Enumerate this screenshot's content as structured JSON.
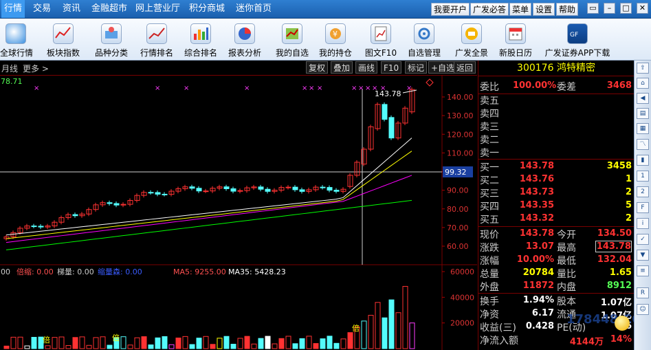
{
  "menubar": {
    "items": [
      "行情",
      "交易",
      "资讯",
      "金融超市",
      "网上营业厅",
      "积分商城",
      "迷你首页"
    ],
    "buttons": [
      "我要开户",
      "广发必答",
      "菜单",
      "设置",
      "帮助"
    ]
  },
  "toolbar": {
    "items": [
      "全球行情",
      "板块指数",
      "品种分类",
      "行情排名",
      "综合排名",
      "报表分析",
      "我的自选",
      "我的持仓",
      "图文F10",
      "自选管理",
      "广发全景",
      "新股日历",
      "广发证券APP下载"
    ]
  },
  "chart_header": {
    "period": "月线",
    "more": "更多 >",
    "buttons": [
      "复权",
      "叠加",
      "画线",
      "F10",
      "标记",
      "+自选",
      "返回"
    ]
  },
  "price_chart": {
    "top_left_value": "78.71",
    "high_label": "143.78",
    "crosshair_value": "99.32",
    "y_ticks": [
      "140.00",
      "130.00",
      "120.00",
      "110.00",
      "100.00",
      "90.00",
      "80.00",
      "70.00",
      "60.00"
    ]
  },
  "volume_chart": {
    "labels": [
      "00",
      "倍缩: 0.00",
      "梯量: 0.00",
      "缩量森: 0.00",
      "MA5: 9255.00",
      "MA35: 5428.23"
    ],
    "y_ticks": [
      "60000",
      "40000",
      "20000"
    ],
    "marker": "倍"
  },
  "stock": {
    "code": "300176",
    "name": "鸿特精密",
    "weibi_label": "委比",
    "weibi": "100.00%",
    "weicha_label": "委差",
    "weicha": "3468",
    "sell": [
      {
        "label": "卖五",
        "price": "",
        "vol": ""
      },
      {
        "label": "卖四",
        "price": "",
        "vol": ""
      },
      {
        "label": "卖三",
        "price": "",
        "vol": ""
      },
      {
        "label": "卖二",
        "price": "",
        "vol": ""
      },
      {
        "label": "卖一",
        "price": "",
        "vol": ""
      }
    ],
    "buy": [
      {
        "label": "买一",
        "price": "143.78",
        "vol": "3458"
      },
      {
        "label": "买二",
        "price": "143.76",
        "vol": "1"
      },
      {
        "label": "买三",
        "price": "143.73",
        "vol": "2"
      },
      {
        "label": "买四",
        "price": "143.35",
        "vol": "5"
      },
      {
        "label": "买五",
        "price": "143.32",
        "vol": "2"
      }
    ],
    "stats": [
      {
        "l1": "现价",
        "v1": "143.78",
        "l2": "今开",
        "v2": "134.50"
      },
      {
        "l1": "涨跌",
        "v1": "13.07",
        "l2": "最高",
        "v2": "143.78"
      },
      {
        "l1": "涨幅",
        "v1": "10.00%",
        "l2": "最低",
        "v2": "132.04"
      },
      {
        "l1": "总量",
        "v1": "20784",
        "l2": "量比",
        "v2": "1.65"
      },
      {
        "l1": "外盘",
        "v1": "11872",
        "l2": "内盘",
        "v2": "8912"
      }
    ],
    "stats2": [
      {
        "l1": "换手",
        "v1": "1.94%",
        "l2": "股本",
        "v2": "1.07亿"
      },
      {
        "l1": "净资",
        "v1": "6.17",
        "l2": "流通",
        "v2": "1.07亿"
      },
      {
        "l1": "收益(三)",
        "v1": "0.428",
        "l2": "PE(动)",
        "v2": "16"
      }
    ],
    "net_inflow_label": "净流入额",
    "net_inflow": "4144万",
    "net_inflow_pct": "14%"
  },
  "watermark": "178448.COM",
  "side_icons": [
    "arrow-up-left-icon",
    "home-icon",
    "arrow-left-icon",
    "arrow-right-icon",
    "table-icon",
    "grid-icon",
    "line-chart-icon",
    "kline-icon",
    "num1-icon",
    "num2-icon",
    "f10-icon",
    "info-icon",
    "tick-icon",
    "arrow-down-icon",
    "list-icon",
    "rsi-icon",
    "smile-icon"
  ],
  "colors": {
    "up": "#ff3232",
    "down": "#54fcfc",
    "accent": "#ffff00"
  }
}
